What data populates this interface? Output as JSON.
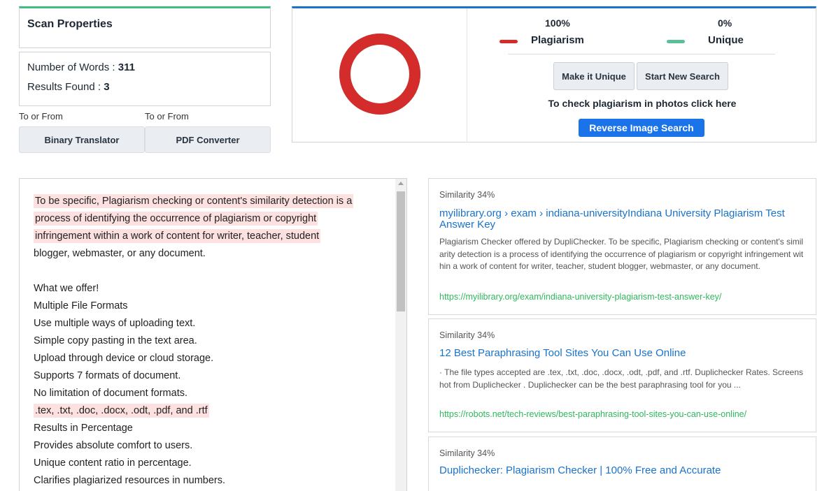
{
  "scan": {
    "title": "Scan Properties",
    "words_label": "Number of Words : ",
    "words_value": "311",
    "results_label": "Results Found : ",
    "results_value": "3"
  },
  "tools": [
    {
      "label": "To or From",
      "button": "Binary Translator"
    },
    {
      "label": "To or From",
      "button": "PDF Converter"
    }
  ],
  "summary": {
    "plagiarism_pct": "100%",
    "plagiarism_label": "Plagiarism",
    "plagiarism_value": 100,
    "unique_pct": "0%",
    "unique_label": "Unique",
    "unique_value": 0,
    "colors": {
      "plagiarism": "#d42b2b",
      "unique": "#5bbf9a"
    },
    "make_unique": "Make it Unique",
    "start_new": "Start New Search",
    "photo_text": "To check plagiarism in photos click here",
    "reverse_image": "Reverse Image Search"
  },
  "text_lines": [
    {
      "text": "To be specific, Plagiarism checking or content's similarity detection is a",
      "hl": true
    },
    {
      "text": "process of identifying the occurrence of plagiarism or copyright",
      "hl": true
    },
    {
      "text": "infringement within a work of content for writer, teacher, student",
      "hl": true
    },
    {
      "text": "blogger, webmaster, or any document.",
      "hl": false
    },
    {
      "text": "",
      "hl": false
    },
    {
      "text": "What we offer!",
      "hl": false
    },
    {
      "text": " Multiple File Formats",
      "hl": false
    },
    {
      "text": "Use multiple ways of uploading text.",
      "hl": false
    },
    {
      "text": "Simple copy pasting in the text area.",
      "hl": false
    },
    {
      "text": "Upload through device or cloud storage.",
      "hl": false
    },
    {
      "text": "Supports 7 formats of document.",
      "hl": false
    },
    {
      "text": "No limitation of document formats.",
      "hl": false
    },
    {
      "text": ".tex, .txt, .doc, .docx, .odt, .pdf, and .rtf",
      "hl": true
    },
    {
      "text": " Results in Percentage",
      "hl": false
    },
    {
      "text": "Provides absolute comfort to users.",
      "hl": false
    },
    {
      "text": "Unique content ratio in percentage.",
      "hl": false
    },
    {
      "text": "Clarifies plagiarized resources in numbers.",
      "hl": false
    }
  ],
  "results": [
    {
      "similarity": "Similarity 34%",
      "title": "myilibrary.org › exam › indiana-universityIndiana University Plagiarism Test Answer Key",
      "description": "Plagiarism Checker offered by DupliChecker. To be specific, Plagiarism checking or content's similarity detection is a process of identifying the occurrence of plagiarism or copyright infringement within a work of content for writer, teacher, student blogger, webmaster, or any document.",
      "url": "https://myilibrary.org/exam/indiana-university-plagiarism-test-answer-key/"
    },
    {
      "similarity": "Similarity 34%",
      "title": "12 Best Paraphrasing Tool Sites You Can Use Online",
      "description": " · The file types accepted are .tex, .txt, .doc, .docx, .odt, .pdf, and .rtf. Duplichecker Rates. Screenshot from Duplichecker . Duplichecker can be the best paraphrasing tool for you ...",
      "url": "https://robots.net/tech-reviews/best-paraphrasing-tool-sites-you-can-use-online/"
    },
    {
      "similarity": "Similarity 34%",
      "title": "Duplichecker: Plagiarism Checker | 100% Free and Accurate",
      "description": "",
      "url": ""
    }
  ]
}
